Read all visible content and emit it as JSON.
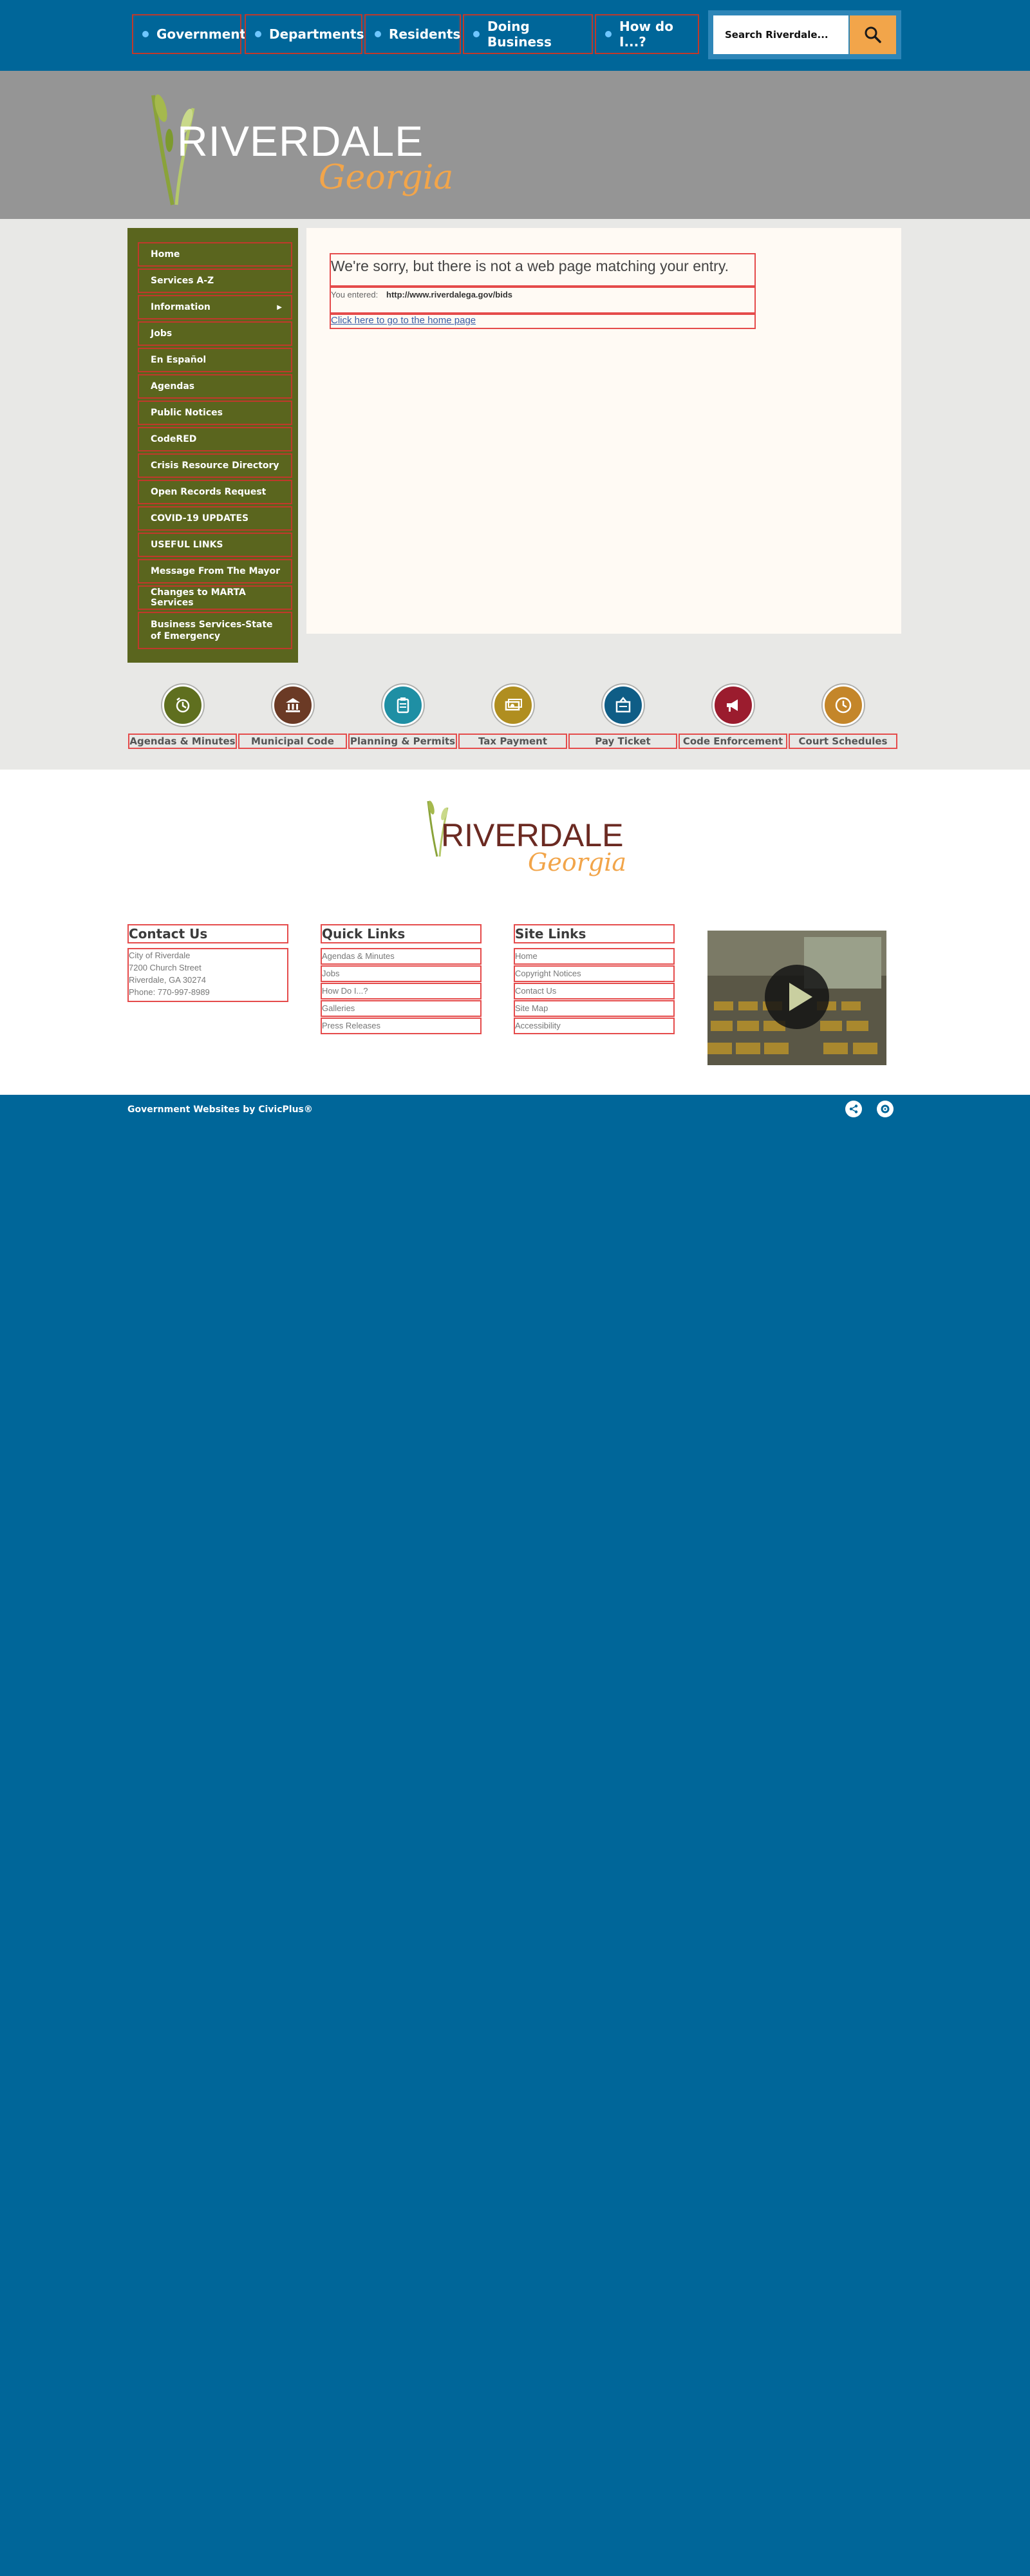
{
  "nav": {
    "items": [
      {
        "label": "Government"
      },
      {
        "label": "Departments"
      },
      {
        "label": "Residents"
      },
      {
        "label": "Doing Business"
      },
      {
        "label": "How do I...?"
      }
    ],
    "search_placeholder": "Search Riverdale..."
  },
  "header": {
    "logo_main": "RIVERDALE",
    "logo_sub": "Georgia"
  },
  "sidebar": {
    "items": [
      {
        "label": "Home"
      },
      {
        "label": "Services A-Z"
      },
      {
        "label": "Information"
      },
      {
        "label": "Jobs"
      },
      {
        "label": "En Español"
      },
      {
        "label": "Agendas"
      },
      {
        "label": "Public Notices"
      },
      {
        "label": "CodeRED"
      },
      {
        "label": "Crisis Resource Directory"
      },
      {
        "label": "Open Records Request"
      },
      {
        "label": "COVID-19 UPDATES"
      },
      {
        "label": "USEFUL LINKS"
      },
      {
        "label": "Message From The Mayor"
      },
      {
        "label": "Changes to MARTA Services"
      },
      {
        "label": "Business Services-State of Emergency"
      }
    ]
  },
  "error": {
    "title": "We're sorry, but there is not a web page matching your entry.",
    "entered_label": "You entered:",
    "entered_url": "http://www.riverdalega.gov/bids",
    "home_link": "Click here to go to the home page"
  },
  "quick_links": [
    {
      "label": "Agendas & Minutes",
      "icon": "agendas-icon",
      "color": "#5f6f1f"
    },
    {
      "label": "Municipal Code",
      "icon": "courthouse-icon",
      "color": "#6b3a25"
    },
    {
      "label": "Planning & Permits",
      "icon": "clipboard-icon",
      "color": "#1f8fa4"
    },
    {
      "label": "Tax Payment",
      "icon": "money-icon",
      "color": "#b08e20"
    },
    {
      "label": "Pay Ticket",
      "icon": "ticket-icon",
      "color": "#0f5d86"
    },
    {
      "label": "Code Enforcement",
      "icon": "megaphone-icon",
      "color": "#9b1c2e"
    },
    {
      "label": "Court Schedules",
      "icon": "clock-icon",
      "color": "#c4862a"
    }
  ],
  "footer": {
    "logo_main": "RIVERDALE",
    "logo_sub": "Georgia",
    "contact": {
      "heading": "Contact Us",
      "lines": [
        "City of Riverdale",
        "7200 Church Street",
        "Riverdale, GA 30274",
        "Phone: 770-997-8989"
      ]
    },
    "quick": {
      "heading": "Quick Links",
      "links": [
        "Agendas & Minutes",
        "Jobs",
        "How Do I...?",
        "Galleries",
        "Press Releases"
      ]
    },
    "site": {
      "heading": "Site Links",
      "links": [
        "Home",
        "Copyright Notices",
        "Contact Us",
        "Site Map",
        "Accessibility"
      ]
    },
    "credit": "Government Websites by CivicPlus®"
  },
  "colors": {
    "brand_blue": "#006699",
    "sidebar_green": "#5a651e",
    "accent_orange": "#f2a54a"
  }
}
